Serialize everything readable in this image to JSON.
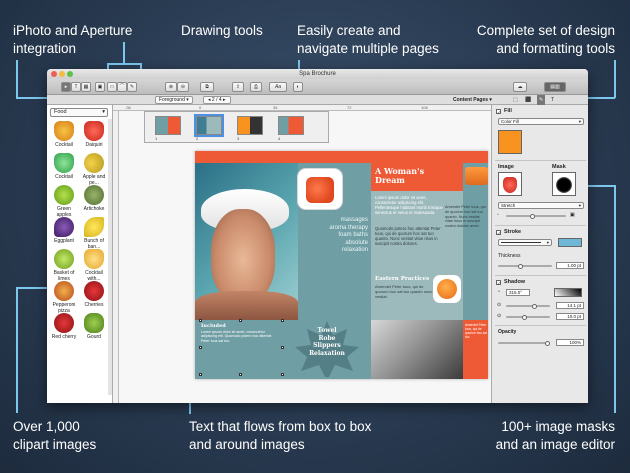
{
  "callouts": {
    "iphoto": "iPhoto and Aperture\nintegration",
    "drawing": "Drawing tools",
    "pages": "Easily create and\nnavigate multiple pages",
    "design": "Complete set of design\nand formatting tools",
    "clipart": "Over 1,000\nclipart images",
    "textflow": "Text that flows from box to box\nand around images",
    "masks": "100+ image masks\nand an image editor"
  },
  "window": {
    "title": "Spa Brochure",
    "foreground": "Foreground",
    "page_nav": "2 / 4",
    "content_pages": "Content Pages"
  },
  "clipart": {
    "category": "Food",
    "items": [
      "Cocktail",
      "Daiquiri",
      "Cocktail",
      "Apple and pe...",
      "Green apples",
      "Artichoke",
      "Eggplant",
      "Bunch of ban...",
      "Basket of limes",
      "Cocktail with...",
      "Pepperoni pizza",
      "Cherries",
      "Red cherry",
      "Gourd"
    ]
  },
  "ruler": {
    "marks": [
      "-36",
      "0",
      "36",
      "72",
      "108"
    ]
  },
  "pagestrip": {
    "nums": [
      "1",
      "2",
      "3",
      "4"
    ]
  },
  "brochure": {
    "title": "A Woman's\nDream",
    "massages": "massages\naroma therapy\nfoam baths\nabsolute\nrelaxation",
    "loremA": "Lorem ipsum dolor sit amet, consectetur adipiscing elit. Pellentesque habitant morbi tristique senectus et netus et malesuada.",
    "loremB": "Quomodo potero hoc attentat Peter tuus, qui de quorum hoc sat tuo quanto. Nunc vestiat vitae risus in suscipit nostra dolores.",
    "eastern": "Eastern Practices",
    "loremC": "Amendet Peter tuus, qui de quorum hoc sat tuo quanto nunc vestiat.",
    "loremR": "Amendet Peter tuus, qui de quorum hoc sat tuo quanto. Nunc vestiat vitae risus in suscipit nostra dolores amet.",
    "included": "Included",
    "inc_text": "Lorem ipsum dolor sit amet, consectetur adipiscing elit. Quomodo potero hoc attentat Peter tuus sat tuo.",
    "leaf": "Towel\nRobe\nSlippers\nRelaxation",
    "loremO": "Amendet Peter tuus, qui de quorum hoc sat tuo."
  },
  "inspector": {
    "fill": "Fill",
    "fill_type": "Color Fill",
    "image": "Image",
    "mask": "Mask",
    "stretch": "Stretch",
    "stroke": "Stroke",
    "thickness": "Thickness",
    "thickness_val": "1.00 pt",
    "shadow": "Shadow",
    "angle": "315.0°",
    "shadow_v1": "14.1 pt",
    "shadow_v2": "10.0 pt",
    "opacity": "Opacity",
    "opacity_val": "100%",
    "fill_color": "#f7931e",
    "stroke_color": "#6fb7d6"
  },
  "colors": {
    "accent_line": "#7cc7ee",
    "coral": "#ef5a36",
    "teal": "#6f9ea4"
  }
}
